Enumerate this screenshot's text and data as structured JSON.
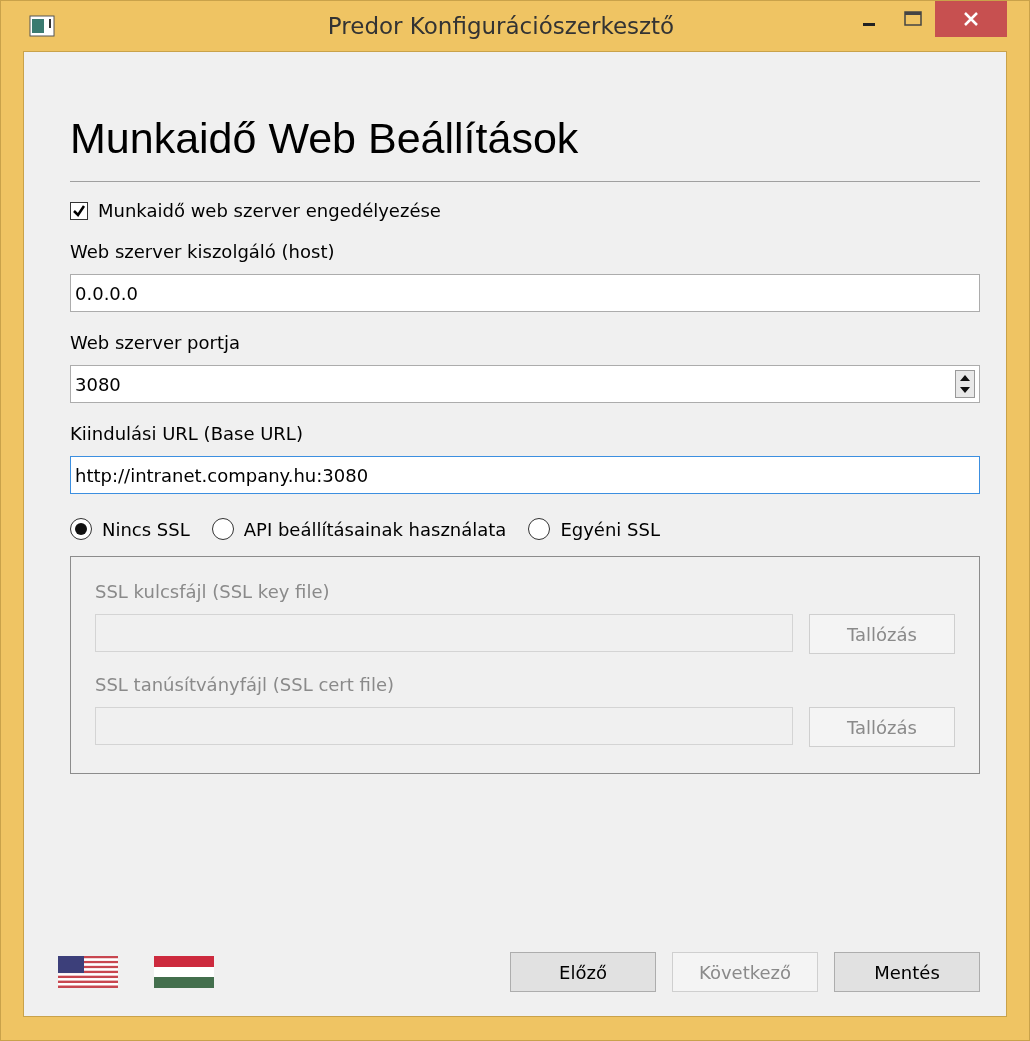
{
  "window": {
    "title": "Predor Konfigurációszerkesztő"
  },
  "heading": "Munkaidő Web Beállítások",
  "enable": {
    "label": "Munkaidő web szerver engedélyezése",
    "checked": true
  },
  "fields": [
    {
      "kind": "text",
      "label": "Web szerver kiszolgáló (host)",
      "value": "0.0.0.0",
      "focused": false
    },
    {
      "kind": "spin",
      "label": "Web szerver portja",
      "value": "3080",
      "focused": false
    },
    {
      "kind": "text",
      "label": "Kiindulási URL (Base URL)",
      "value": "http://intranet.company.hu:3080",
      "focused": true
    }
  ],
  "ssl_options": [
    {
      "label": "Nincs SSL",
      "selected": true
    },
    {
      "label": "API beállításainak használata",
      "selected": false
    },
    {
      "label": "Egyéni SSL",
      "selected": false
    }
  ],
  "ssl_group": {
    "disabled": true,
    "files": [
      {
        "label": "SSL kulcsfájl (SSL key file)",
        "button": "Tallózás"
      },
      {
        "label": "SSL tanúsítványfájl (SSL cert file)",
        "button": "Tallózás"
      }
    ]
  },
  "languages": [
    {
      "kind": "us"
    },
    {
      "kind": "hu"
    }
  ],
  "buttons": [
    {
      "label": "Előző",
      "disabled": false
    },
    {
      "label": "Következő",
      "disabled": true
    },
    {
      "label": "Mentés",
      "disabled": false
    }
  ]
}
